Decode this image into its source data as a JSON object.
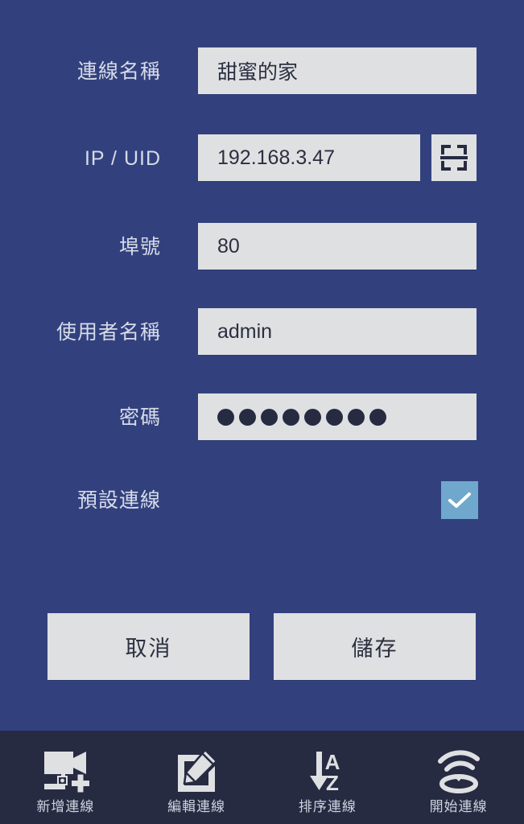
{
  "theme": {
    "background": "#32417e",
    "field_background": "#dfe0e2",
    "bottom_bar": "#262b42",
    "checkbox_accent": "#6fa8cc",
    "label_color": "#d7dbe8",
    "value_color": "#2b3040"
  },
  "form": {
    "fields": [
      {
        "name": "connection-name",
        "label": "連線名稱",
        "value": "甜蜜的家",
        "placeholder": "",
        "type": "text"
      },
      {
        "name": "ip-uid",
        "label": "IP / UID",
        "value": "192.168.3.47",
        "placeholder": "",
        "type": "text"
      },
      {
        "name": "port",
        "label": "埠號",
        "value": "80",
        "placeholder": "",
        "type": "text"
      },
      {
        "name": "username",
        "label": "使用者名稱",
        "value": "admin",
        "placeholder": "",
        "type": "text"
      },
      {
        "name": "password",
        "label": "密碼",
        "value": "••••••••",
        "masked_length": 8,
        "placeholder": "",
        "type": "password"
      }
    ],
    "scan_icon": "qr-scan-icon",
    "default_connection": {
      "label": "預設連線",
      "checked": true,
      "check_icon": "check-icon"
    },
    "buttons": {
      "cancel_label": "取消",
      "save_label": "儲存"
    }
  },
  "bottom_nav": {
    "items": [
      {
        "label": "新增連線",
        "icon": "camera-add-icon"
      },
      {
        "label": "編輯連線",
        "icon": "edit-pencil-icon"
      },
      {
        "label": "排序連線",
        "icon": "sort-az-icon"
      },
      {
        "label": "開始連線",
        "icon": "wifi-connect-icon"
      }
    ]
  }
}
